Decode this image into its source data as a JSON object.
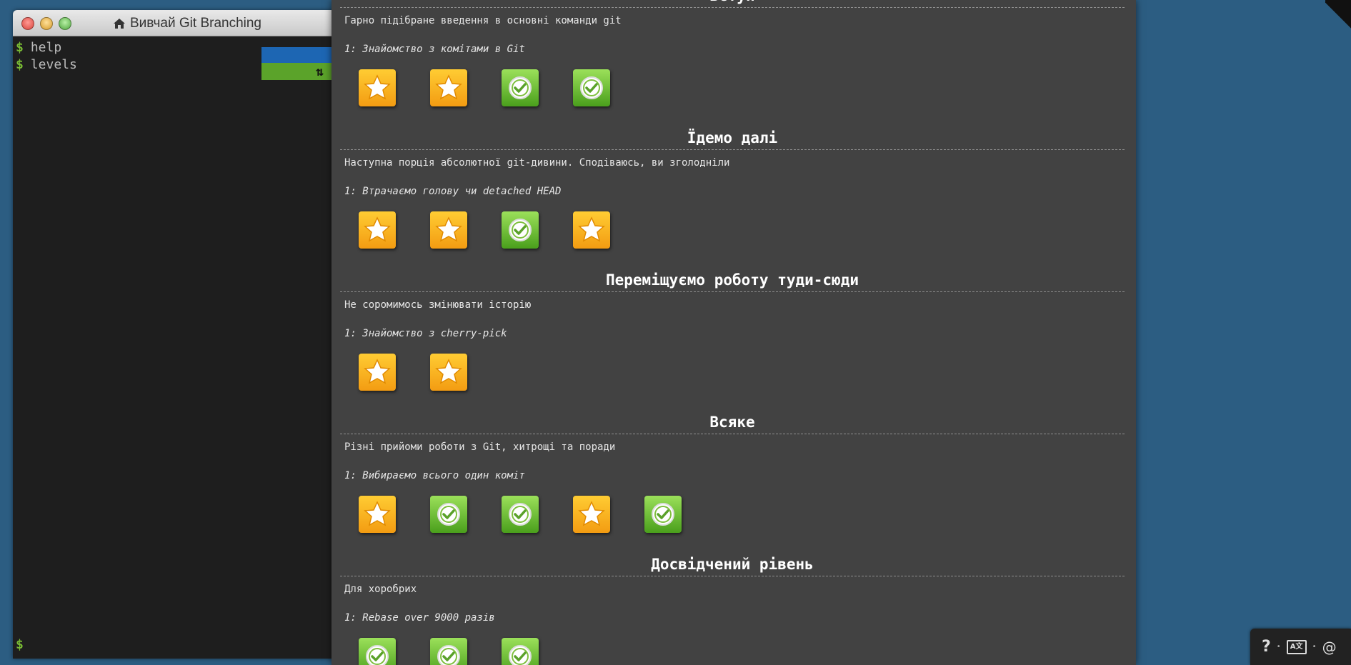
{
  "terminal": {
    "title": "Вивчай Git Branching",
    "commands": [
      {
        "prompt": "$",
        "text": "help"
      },
      {
        "prompt": "$",
        "text": "levels"
      }
    ],
    "bottom_prompt": "$",
    "sort_glyph": "⇅"
  },
  "modal": {
    "partial_title": "Вступ",
    "sequences": [
      {
        "title": "",
        "about": "Гарно підібране введення в основні команди git",
        "level": "1: Знайомство з комітами в Git",
        "levels": [
          "star",
          "star",
          "done",
          "done"
        ]
      },
      {
        "title": "Їдемо далі",
        "about": "Наступна порція абсолютної git-дивини. Сподіваюсь, ви зголодніли",
        "level": "1: Втрачаємо голову чи detached HEAD",
        "levels": [
          "star",
          "star",
          "done",
          "star"
        ]
      },
      {
        "title": "Переміщуємо роботу туди-сюди",
        "about": "Не соромимось змінювати історію",
        "level": "1: Знайомство з cherry-pick",
        "levels": [
          "star",
          "star"
        ]
      },
      {
        "title": "Всяке",
        "about": "Різні прийоми роботи з Git, хитрощі та поради",
        "level": "1: Вибираємо всього один коміт",
        "levels": [
          "star",
          "done",
          "done",
          "star",
          "done"
        ]
      },
      {
        "title": "Досвідчений рівень",
        "about": "Для хоробрих",
        "level": "1: Rebase over 9000 разів",
        "levels": [
          "done",
          "done",
          "done"
        ]
      }
    ]
  },
  "toolbar": {
    "help_glyph": "?",
    "lang_label": "A文",
    "separator": "•",
    "threads_glyph": "@"
  }
}
